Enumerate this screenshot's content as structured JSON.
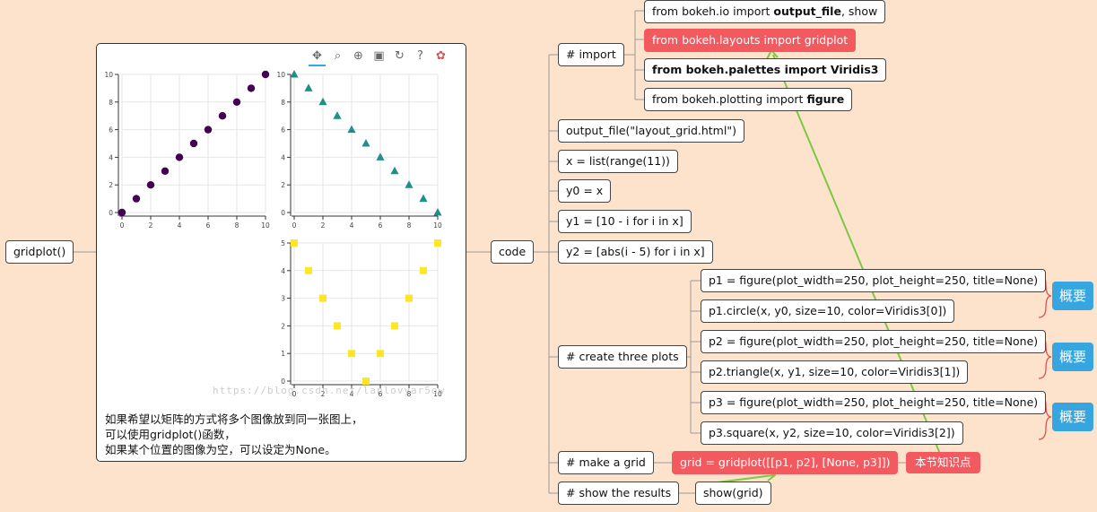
{
  "root": {
    "label": "gridplot()"
  },
  "code_node": {
    "label": "code"
  },
  "panel": {
    "caption_lines": [
      "如果希望以矩阵的方式将多个图像放到同一张图上，",
      "可以使用gridplot()函数，",
      "如果某个位置的图像为空，可以设定为None。"
    ],
    "watermark": "https://blog.csdn.net/lanlovyar5ow",
    "toolbar": [
      "pan-icon",
      "box-zoom-icon",
      "wheel-zoom-icon",
      "save-icon",
      "reset-icon",
      "help-icon",
      "bokeh-logo-icon"
    ]
  },
  "import": {
    "label": "# import",
    "children": [
      {
        "pre": "from bokeh.io import ",
        "bold": "output_file",
        "post": ", show",
        "style": "normal"
      },
      {
        "pre": "from bokeh.layouts import gridplot",
        "bold": "",
        "post": "",
        "style": "highlight"
      },
      {
        "pre": "from bokeh.palettes import Viridis3",
        "bold": "",
        "post": "",
        "style": "bold"
      },
      {
        "pre": "from bokeh.plotting import ",
        "bold": "figure",
        "post": "",
        "style": "normal"
      }
    ]
  },
  "statements": [
    "output_file(\"layout_grid.html\")",
    "x = list(range(11))",
    "y0 = x",
    "y1 = [10 - i for i in x]",
    "y2 = [abs(i - 5) for i in x]"
  ],
  "create": {
    "label": "# create three plots",
    "children": [
      "p1 = figure(plot_width=250, plot_height=250, title=None)",
      "p1.circle(x, y0, size=10, color=Viridis3[0])",
      "p2 = figure(plot_width=250, plot_height=250, title=None)",
      "p2.triangle(x, y1, size=10, color=Viridis3[1])",
      "p3 = figure(plot_width=250, plot_height=250, title=None)",
      "p3.square(x, y2, size=10, color=Viridis3[2])"
    ],
    "summaries": [
      "概要",
      "概要",
      "概要"
    ]
  },
  "make_grid": {
    "label": "# make a grid",
    "child": "grid = gridplot([[p1, p2], [None, p3]])",
    "tag": "本节知识点"
  },
  "show": {
    "label": "# show the results",
    "child": "show(grid)"
  },
  "colors": {
    "viridis0": "#440154",
    "viridis1": "#208f8c",
    "viridis2": "#fde724",
    "highlight": "#f25a5f",
    "summary": "#37a6e0",
    "connector_arrow": "#7ac943",
    "background": "#fde3cc"
  },
  "chart_data": [
    {
      "type": "scatter",
      "marker": "circle",
      "color": "#440154",
      "x": [
        0,
        1,
        2,
        3,
        4,
        5,
        6,
        7,
        8,
        9,
        10
      ],
      "y": [
        0,
        1,
        2,
        3,
        4,
        5,
        6,
        7,
        8,
        9,
        10
      ],
      "xlim": [
        0,
        10
      ],
      "ylim": [
        0,
        10
      ],
      "xticks": [
        "0",
        "2",
        "4",
        "6",
        "8",
        "10"
      ],
      "yticks": [
        "0",
        "2",
        "4",
        "6",
        "8",
        "10"
      ]
    },
    {
      "type": "scatter",
      "marker": "triangle",
      "color": "#208f8c",
      "x": [
        0,
        1,
        2,
        3,
        4,
        5,
        6,
        7,
        8,
        9,
        10
      ],
      "y": [
        10,
        9,
        8,
        7,
        6,
        5,
        4,
        3,
        2,
        1,
        0
      ],
      "xlim": [
        0,
        10
      ],
      "ylim": [
        0,
        10
      ],
      "xticks": [
        "0",
        "2",
        "4",
        "6",
        "8",
        "10"
      ],
      "yticks": [
        "0",
        "2",
        "4",
        "6",
        "8",
        "10"
      ]
    },
    {
      "type": "scatter",
      "marker": "square",
      "color": "#fde724",
      "x": [
        0,
        1,
        2,
        3,
        4,
        5,
        6,
        7,
        8,
        9,
        10
      ],
      "y": [
        5,
        4,
        3,
        2,
        1,
        0,
        1,
        2,
        3,
        4,
        5
      ],
      "xlim": [
        0,
        10
      ],
      "ylim": [
        0,
        5
      ],
      "xticks": [
        "0",
        "2",
        "4",
        "6",
        "8",
        "10"
      ],
      "yticks": [
        "0",
        "1",
        "2",
        "3",
        "4",
        "5"
      ]
    }
  ]
}
